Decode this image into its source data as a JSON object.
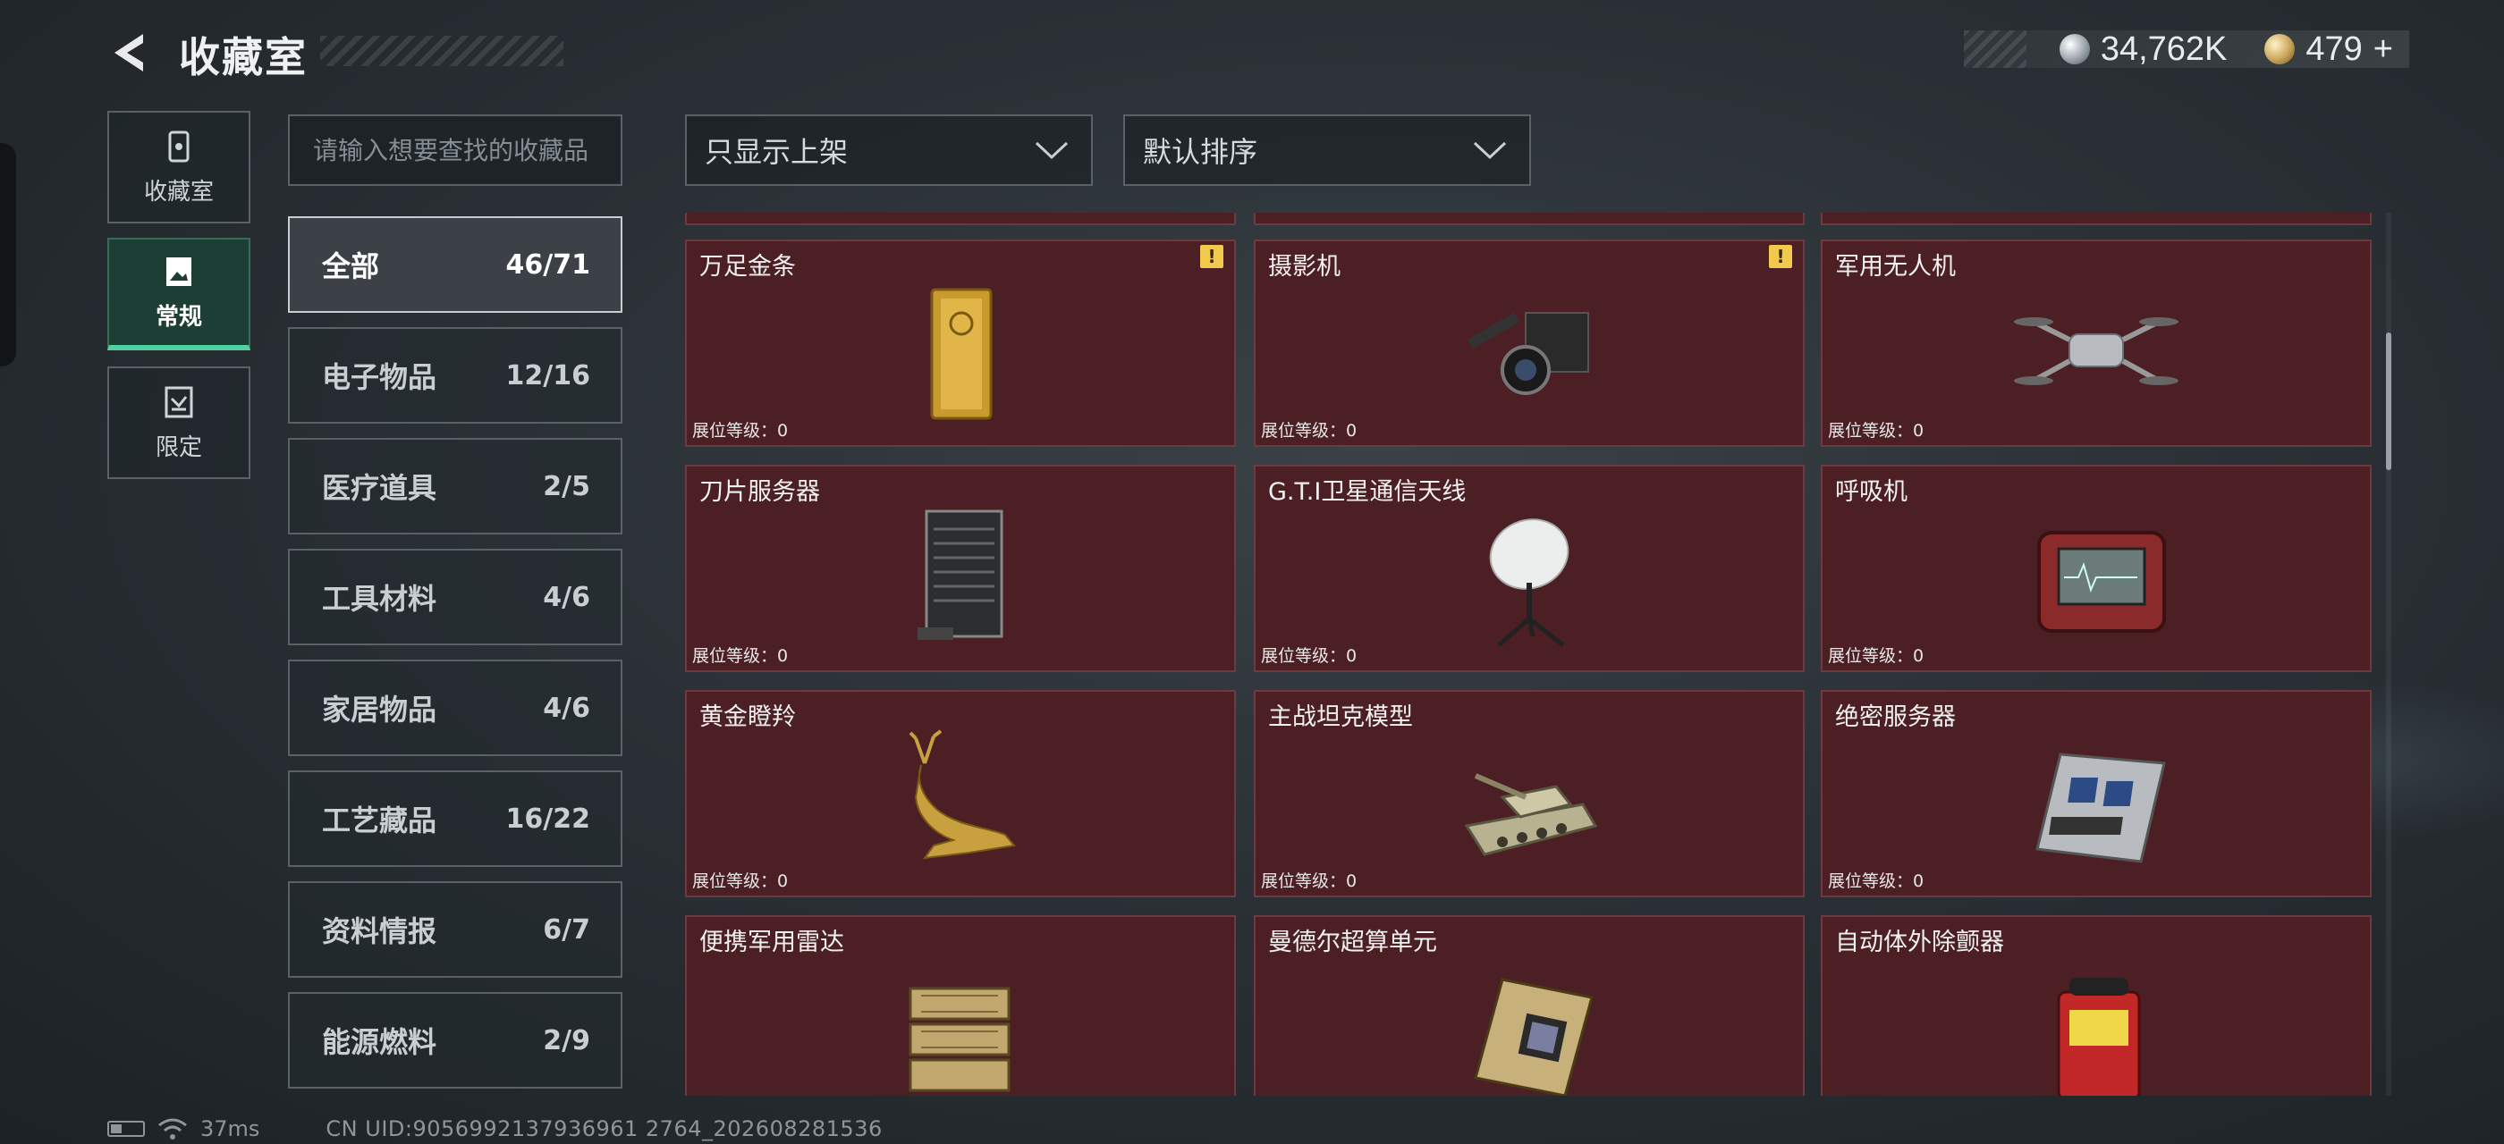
{
  "header": {
    "title": "收藏室",
    "back_icon": "back-arrow-icon"
  },
  "currency": {
    "silver_value": "34,762K",
    "gold_value": "479",
    "gold_add": "+"
  },
  "rail": [
    {
      "label": "收藏室",
      "icon": "vault-icon",
      "active": false
    },
    {
      "label": "常规",
      "icon": "document-icon",
      "active": true
    },
    {
      "label": "限定",
      "icon": "limited-icon",
      "active": false
    }
  ],
  "search": {
    "placeholder": "请输入想要查找的收藏品"
  },
  "categories": [
    {
      "name": "全部",
      "count": "46/71",
      "active": true
    },
    {
      "name": "电子物品",
      "count": "12/16"
    },
    {
      "name": "医疗道具",
      "count": "2/5"
    },
    {
      "name": "工具材料",
      "count": "4/6"
    },
    {
      "name": "家居物品",
      "count": "4/6"
    },
    {
      "name": "工艺藏品",
      "count": "16/22"
    },
    {
      "name": "资料情报",
      "count": "6/7"
    },
    {
      "name": "能源燃料",
      "count": "2/9"
    }
  ],
  "filters": {
    "filter_value": "只显示上架",
    "sort_value": "默认排序"
  },
  "items": [
    {
      "name": "万足金条",
      "level": "展位等级：0",
      "warn": "!",
      "icon": "gold-bar-icon"
    },
    {
      "name": "摄影机",
      "level": "展位等级：0",
      "warn": "!",
      "icon": "camera-icon"
    },
    {
      "name": "军用无人机",
      "level": "展位等级：0",
      "icon": "drone-icon"
    },
    {
      "name": "刀片服务器",
      "level": "展位等级：0",
      "icon": "blade-server-icon"
    },
    {
      "name": "G.T.I卫星通信天线",
      "level": "展位等级：0",
      "icon": "satellite-dish-icon"
    },
    {
      "name": "呼吸机",
      "level": "展位等级：0",
      "icon": "ventilator-icon"
    },
    {
      "name": "黄金瞪羚",
      "level": "展位等级：0",
      "icon": "gazelle-icon"
    },
    {
      "name": "主战坦克模型",
      "level": "展位等级：0",
      "icon": "tank-icon"
    },
    {
      "name": "绝密服务器",
      "level": "展位等级：0",
      "icon": "server-board-icon"
    },
    {
      "name": "便携军用雷达",
      "level": "",
      "icon": "radar-icon"
    },
    {
      "name": "曼德尔超算单元",
      "level": "",
      "icon": "compute-unit-icon"
    },
    {
      "name": "自动体外除颤器",
      "level": "",
      "icon": "defibrillator-icon"
    }
  ],
  "statusbar": {
    "ping": "37ms",
    "uid": "CN UID:9056992137936961 2764_202608281536"
  }
}
